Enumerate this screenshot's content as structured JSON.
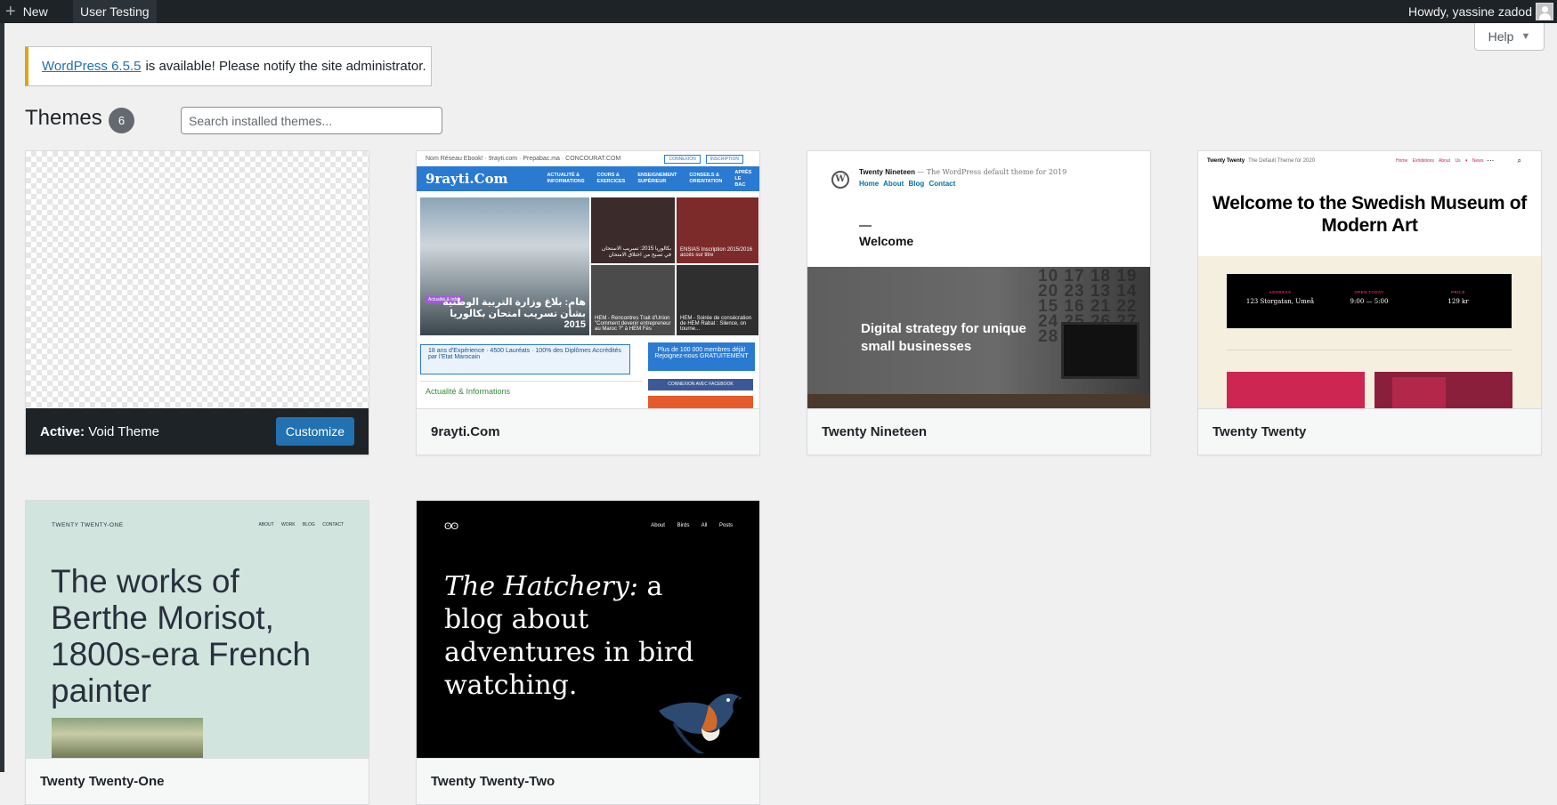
{
  "admin_bar": {
    "new_label": "New",
    "site_label": "User Testing",
    "howdy": "Howdy, yassine zadod"
  },
  "help": {
    "label": "Help"
  },
  "notice": {
    "link": "WordPress 6.5.5",
    "text": "is available! Please notify the site administrator."
  },
  "page": {
    "title": "Themes",
    "count": "6",
    "search_placeholder": "Search installed themes..."
  },
  "themes": [
    {
      "name": "Void Theme",
      "active_prefix": "Active:",
      "action": "Customize"
    },
    {
      "name": "9rayti.Com"
    },
    {
      "name": "Twenty Nineteen"
    },
    {
      "name": "Twenty Twenty"
    },
    {
      "name": "Twenty Twenty-One"
    },
    {
      "name": "Twenty Twenty-Two"
    }
  ],
  "previews": {
    "rayti": {
      "top_links": "Nom Réseau Ebook! · 9rayti.com · Prepabac.ma · CONCOURAT.COM",
      "connexion": "CONNEXION",
      "inscription": "INSCRIPTION",
      "logo": "9rayti.Com",
      "menu": [
        "ACTUALITÉ & INFORMATIONS",
        "COURS & EXERCICES",
        "ENSEIGNEMENT SUPÉRIEUR",
        "CONSEILS & ORIENTATION",
        "APRÈS LE BAC"
      ],
      "photo_caption": "هام: بلاغ وزارة التربية الوطنية بشأن تسريب امتحان بكالوريا 2015",
      "tag": "Actualité & Infos",
      "tile1": "بكالوريا 2015: تسريب الاستحان في تصبح من اختلاق الامتحان",
      "tile2": "ENSIAS Inscription 2015/2016 accès sur titre",
      "tile3": "HEM - Rencontres Trait d'Union \"Comment devenir entrepreneur au Maroc ?\" à HEM Fès",
      "tile4": "HEM - Soirée de consécration de HEM Rabat : Silence, on tourne...",
      "banner": "18 ans d'Expérience · 4500 Lauréats · 100% des Diplômes Accrédités par l'Etat Marocain",
      "promo": "Plus de 100 000 membres déjà! Rejoignez-nous GRATUITEMENT",
      "fb": "CONNEXION AVEC FACEBOOK",
      "section": "Actualité & Informations"
    },
    "nineteen": {
      "site": "Twenty Nineteen",
      "tagline": "— The WordPress default theme for 2019",
      "nav": "Home About Blog Contact",
      "welcome": "Welcome",
      "hero": "Digital strategy for unique small businesses",
      "calendar": "10 17 18 19 20 23 13 14 15 16 21 22 24 25 26 27 28 29"
    },
    "twenty": {
      "brand": "Twenty Twenty",
      "tagline": "The Default Theme for 2020",
      "menu": "Home Exhibitions About Us ▾ News",
      "icons": "⋯ ⌕",
      "headline": "Welcome to the Swedish Museum of Modern Art",
      "address_label": "ADDRESS",
      "address": "123 Storgatan, Umeå",
      "hours_label": "OPEN TODAY",
      "hours": "9:00 — 5:00",
      "price_label": "PRICE",
      "price": "129 kr"
    },
    "twentyone": {
      "site": "TWENTY TWENTY-ONE",
      "menu": "ABOUT WORK BLOG CONTACT",
      "headline": "The works of Berthe Morisot, 1800s-era French painter"
    },
    "twentytwo": {
      "logo": "ʘʘ",
      "menu": "About Birds All Posts",
      "headline_em": "The Hatchery:",
      "headline": " a blog about adventures in bird watching."
    }
  },
  "colors": {
    "admin_bar": "#1d2327",
    "accent": "#2271b1",
    "notice_border": "#dba617",
    "page_bg": "#f0f0f1"
  }
}
